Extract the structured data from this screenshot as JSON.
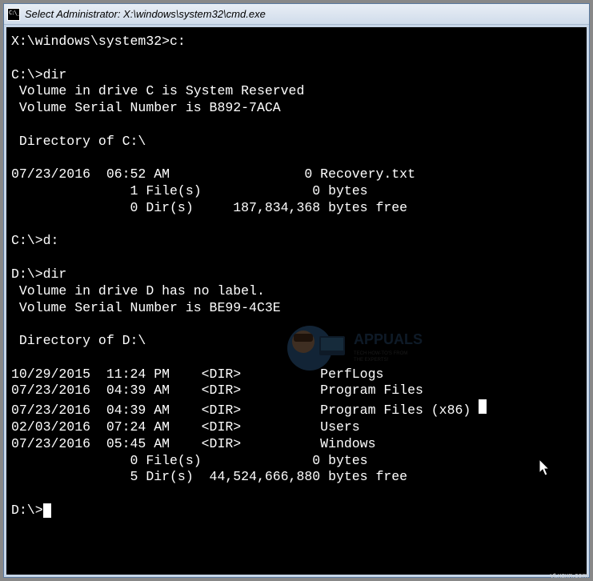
{
  "window": {
    "title": "Select Administrator: X:\\windows\\system32\\cmd.exe"
  },
  "terminal": {
    "line01": "X:\\windows\\system32>c:",
    "line02": "",
    "line03": "C:\\>dir",
    "line04": " Volume in drive C is System Reserved",
    "line05": " Volume Serial Number is B892-7ACA",
    "line06": "",
    "line07": " Directory of C:\\",
    "line08": "",
    "line09": "07/23/2016  06:52 AM                 0 Recovery.txt",
    "line10": "               1 File(s)              0 bytes",
    "line11": "               0 Dir(s)     187,834,368 bytes free",
    "line12": "",
    "line13": "C:\\>d:",
    "line14": "",
    "line15": "D:\\>dir",
    "line16": " Volume in drive D has no label.",
    "line17": " Volume Serial Number is BE99-4C3E",
    "line18": "",
    "line19": " Directory of D:\\",
    "line20": "",
    "line21": "10/29/2015  11:24 PM    <DIR>          PerfLogs",
    "line22": "07/23/2016  04:39 AM    <DIR>          Program Files",
    "line23": "07/23/2016  04:39 AM    <DIR>          Program Files (x86) ",
    "line24": "02/03/2016  07:24 AM    <DIR>          Users",
    "line25": "07/23/2016  05:45 AM    <DIR>          Windows",
    "line26": "               0 File(s)              0 bytes",
    "line27": "               5 Dir(s)  44,524,666,880 bytes free",
    "line28": "",
    "line29": "D:\\>"
  },
  "watermark": {
    "brand": "APPUALS",
    "tagline": "TECH HOW-TO'S FROM THE EXPERTS!"
  },
  "source": "vt.xsxn.com",
  "chart_data": {
    "type": "table",
    "note": "Command prompt directory listings",
    "drives": [
      {
        "path": "C:\\",
        "volume_label": "System Reserved",
        "serial": "B892-7ACA",
        "entries": [
          {
            "date": "07/23/2016",
            "time": "06:52 AM",
            "type": "file",
            "size": 0,
            "name": "Recovery.txt"
          }
        ],
        "file_count": 1,
        "file_bytes": 0,
        "dir_count": 0,
        "bytes_free": 187834368
      },
      {
        "path": "D:\\",
        "volume_label": null,
        "serial": "BE99-4C3E",
        "entries": [
          {
            "date": "10/29/2015",
            "time": "11:24 PM",
            "type": "DIR",
            "name": "PerfLogs"
          },
          {
            "date": "07/23/2016",
            "time": "04:39 AM",
            "type": "DIR",
            "name": "Program Files"
          },
          {
            "date": "07/23/2016",
            "time": "04:39 AM",
            "type": "DIR",
            "name": "Program Files (x86)"
          },
          {
            "date": "02/03/2016",
            "time": "07:24 AM",
            "type": "DIR",
            "name": "Users"
          },
          {
            "date": "07/23/2016",
            "time": "05:45 AM",
            "type": "DIR",
            "name": "Windows"
          }
        ],
        "file_count": 0,
        "file_bytes": 0,
        "dir_count": 5,
        "bytes_free": 44524666880
      }
    ]
  }
}
